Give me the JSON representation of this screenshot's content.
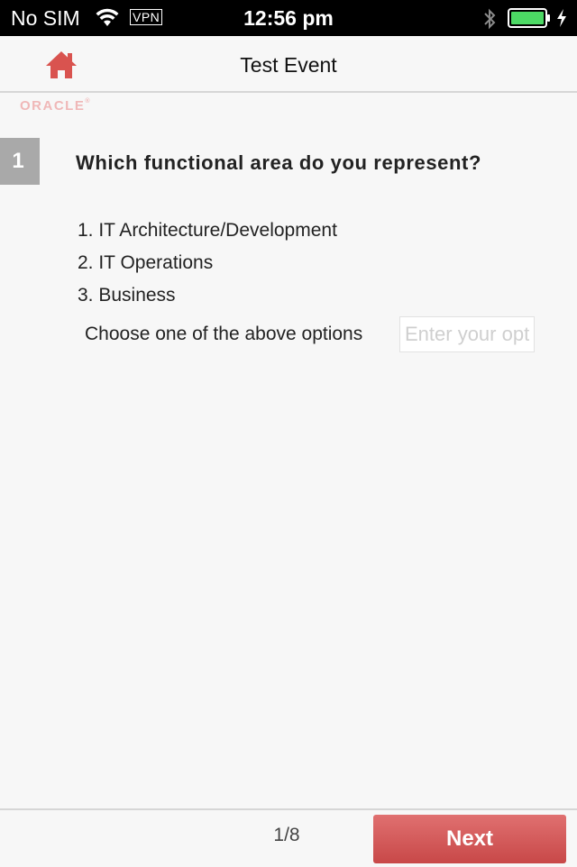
{
  "status_bar": {
    "carrier": "No SIM",
    "vpn": "VPN",
    "time": "12:56 pm",
    "icons": [
      "wifi-icon",
      "bluetooth-icon",
      "battery-icon",
      "charging-icon"
    ]
  },
  "nav": {
    "title": "Test Event",
    "home_icon": "home-icon",
    "logo": "ORACLE"
  },
  "question": {
    "number": "1",
    "text": "Which functional area do you represent?",
    "options": [
      "1. IT Architecture/Development",
      "2. IT Operations",
      "3. Business"
    ],
    "choose_label": "Choose one of the above options",
    "input_placeholder": "Enter your option",
    "input_value": ""
  },
  "footer": {
    "page_indicator": "1/8",
    "next_label": "Next"
  },
  "colors": {
    "accent": "#d35c5c",
    "number_badge": "#a9a9a9",
    "background": "#f7f7f7"
  }
}
